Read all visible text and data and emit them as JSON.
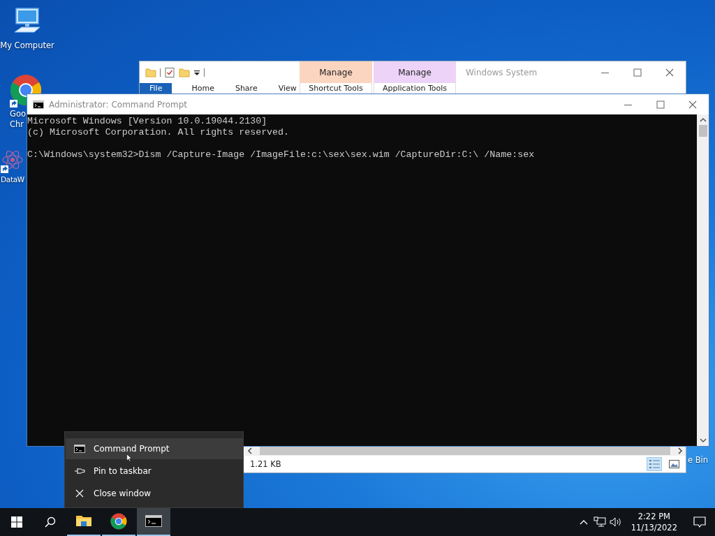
{
  "desktop": {
    "icons": [
      {
        "kind": "computer",
        "label_lines": [
          "My Computer"
        ],
        "shortcut": false
      },
      {
        "kind": "browser",
        "label_lines": [
          "Goo",
          "Chr"
        ],
        "shortcut": true
      },
      {
        "kind": "data",
        "label_lines": [
          "DataW"
        ],
        "shortcut": true
      },
      {
        "kind": "recycle",
        "label_lines": [
          "e Bin"
        ],
        "shortcut": false
      }
    ]
  },
  "explorer": {
    "context_tabs": [
      {
        "header": "Manage",
        "label": "Shortcut Tools",
        "color": "#fcd5c0"
      },
      {
        "header": "Manage",
        "label": "Application Tools",
        "color": "#ecd3f7"
      }
    ],
    "title": "Windows System",
    "ribbon_tabs": [
      {
        "kind": "file",
        "label": "File"
      },
      {
        "kind": "tab",
        "label": "Home"
      },
      {
        "kind": "tab",
        "label": "Share"
      },
      {
        "kind": "tab",
        "label": "View"
      }
    ],
    "size_status": "1.21 KB",
    "view_buttons": [
      {
        "kind": "details",
        "selected": true
      },
      {
        "kind": "large_icons",
        "selected": false
      }
    ]
  },
  "console": {
    "title": "Administrator: Command Prompt",
    "blocks": [
      [
        "Microsoft Windows [Version 10.0.19044.2130]",
        "(c) Microsoft Corporation. All rights reserved."
      ],
      [
        "C:\\Windows\\system32>Dism /Capture-Image /ImageFile:c:\\sex\\sex.wim /CaptureDir:C:\\ /Name:sex"
      ]
    ]
  },
  "jump_list": {
    "items": [
      {
        "kind": "app",
        "label": "Command Prompt",
        "selected": true
      },
      {
        "kind": "pin",
        "label": "Pin to taskbar",
        "selected": false
      },
      {
        "kind": "close",
        "label": "Close window",
        "selected": false
      }
    ]
  },
  "taskbar": {
    "apps": [
      {
        "kind": "explorer",
        "selected": false,
        "running": true
      },
      {
        "kind": "chrome",
        "selected": false,
        "running": true
      },
      {
        "kind": "console",
        "selected": true,
        "running": true
      }
    ],
    "clock": {
      "time": "2:22 PM",
      "date": "11/13/2022"
    }
  }
}
